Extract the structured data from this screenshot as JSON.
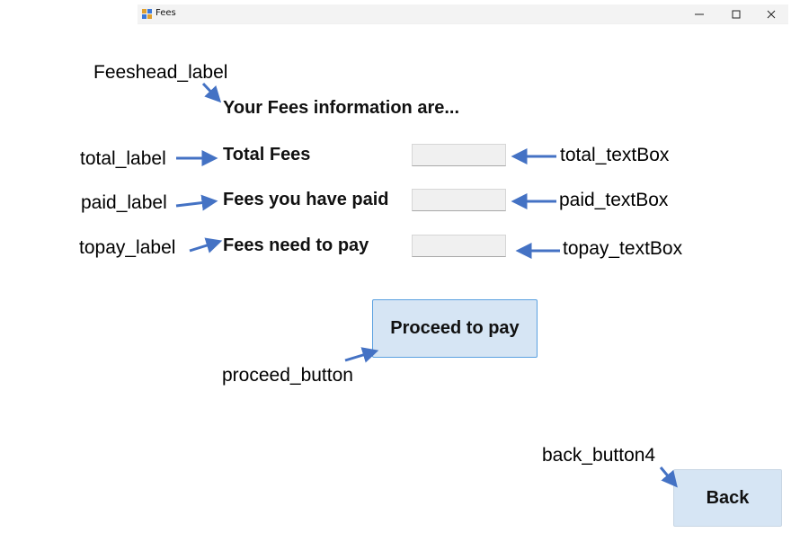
{
  "window": {
    "title": "Fees",
    "icons": [
      "app-icon",
      "minimize-icon",
      "maximize-icon",
      "close-icon"
    ]
  },
  "form": {
    "heading": "Your Fees information are...",
    "total_label": "Total Fees",
    "paid_label": "Fees you have paid",
    "topay_label": "Fees need to pay",
    "total_value": "",
    "paid_value": "",
    "topay_value": "",
    "proceed_button": "Proceed to pay",
    "back_button": "Back"
  },
  "annotations": {
    "feeshead": "Feeshead_label",
    "total_label": "total_label",
    "paid_label": "paid_label",
    "topay_label": "topay_label",
    "total_textbox": "total_textBox",
    "paid_textbox": "paid_textBox",
    "topay_textbox": "topay_textBox",
    "proceed": "proceed_button",
    "back": "back_button4"
  },
  "colors": {
    "arrow": "#4472c4",
    "button_fill": "#d6e5f4",
    "button_border": "#5ba1e0",
    "titlebar": "#f3f3f3",
    "textbox_fill": "#f0f0f0"
  }
}
